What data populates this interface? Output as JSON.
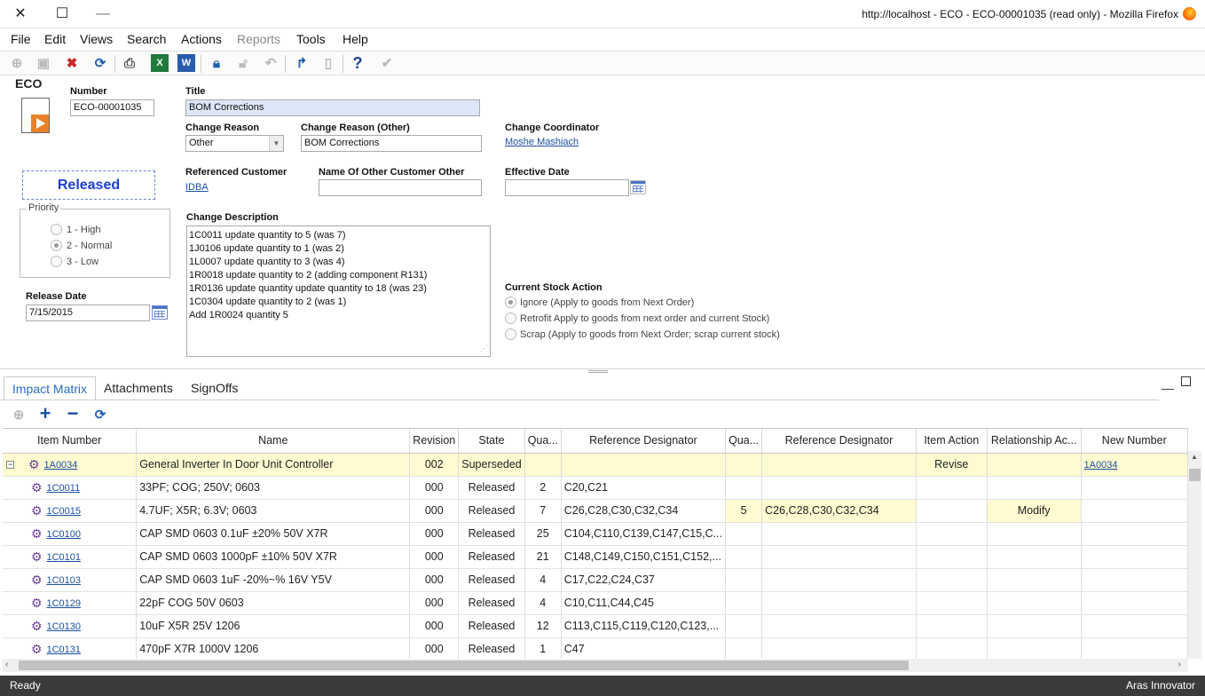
{
  "window": {
    "title": "http://localhost - ECO - ECO-00001035 (read only) - Mozilla Firefox",
    "close_glyph": "✕",
    "maximize_glyph": "☐",
    "minimize_glyph": "—"
  },
  "menu": [
    "File",
    "Edit",
    "Views",
    "Search",
    "Actions",
    "Reports",
    "Tools",
    "Help"
  ],
  "form": {
    "itemtype": "ECO",
    "number_label": "Number",
    "number": "ECO-00001035",
    "title_label": "Title",
    "title": "BOM Corrections",
    "change_reason_label": "Change Reason",
    "change_reason": "Other",
    "change_reason_other_label": "Change Reason (Other)",
    "change_reason_other": "BOM Corrections",
    "change_coordinator_label": "Change Coordinator",
    "change_coordinator": "Moshe Mashiach",
    "state": "Released",
    "referenced_customer_label": "Referenced Customer",
    "referenced_customer": "IDBA",
    "other_customer_label": "Name Of Other Customer Other",
    "other_customer": "",
    "effective_date_label": "Effective Date",
    "effective_date": "",
    "priority_label": "Priority",
    "priorities": [
      "1 - High",
      "2 - Normal",
      "3 - Low"
    ],
    "priority_selected": "2 - Normal",
    "release_date_label": "Release Date",
    "release_date": "7/15/2015",
    "change_description_label": "Change Description",
    "change_description": [
      "1C0011 update quantity to 5 (was 7)",
      "1J0106 update quantity  to 1 (was 2)",
      "1L0007 update quantity  to 3 (was 4)",
      "1R0018 update quantity to 2 (adding component R131)",
      "1R0136 update quantity update quantity  to 18 (was 23)",
      "1C0304 update quantity to 2 (was 1)",
      "Add 1R0024 quantity 5"
    ],
    "stock_action_label": "Current Stock Action",
    "stock_actions": [
      "Ignore (Apply to goods from Next Order)",
      "Retrofit Apply to goods from next order and current Stock)",
      "Scrap (Apply to goods from Next Order; scrap current stock)"
    ],
    "stock_action_selected": "Ignore (Apply to goods from Next Order)"
  },
  "tabs": [
    "Impact Matrix",
    "Attachments",
    "SignOffs"
  ],
  "grid": {
    "columns": [
      "Item Number",
      "Name",
      "Revision",
      "State",
      "Qua...",
      "Reference Designator",
      "Qua...",
      "Reference Designator",
      "Item Action",
      "Relationship Ac...",
      "New Number"
    ],
    "rows": [
      {
        "item": "1A0034",
        "name": "General Inverter In Door Unit Controller",
        "rev": "002",
        "state": "Superseded",
        "qty": "",
        "ref": "",
        "new_qty": "",
        "new_ref": "",
        "action": "Revise",
        "rel_action": "",
        "new_number": "1A0034",
        "parent": true
      },
      {
        "item": "1C0011",
        "name": "33PF; COG; 250V; 0603",
        "rev": "000",
        "state": "Released",
        "qty": "2",
        "ref": "C20,C21",
        "new_qty": "",
        "new_ref": "",
        "action": "",
        "rel_action": "",
        "new_number": ""
      },
      {
        "item": "1C0015",
        "name": "4.7UF; X5R; 6.3V; 0603",
        "rev": "000",
        "state": "Released",
        "qty": "7",
        "ref": "C26,C28,C30,C32,C34",
        "new_qty": "5",
        "new_ref": "C26,C28,C30,C32,C34",
        "action": "",
        "rel_action": "Modify",
        "new_number": ""
      },
      {
        "item": "1C0100",
        "name": "CAP SMD 0603 0.1uF ±20% 50V X7R",
        "rev": "000",
        "state": "Released",
        "qty": "25",
        "ref": "C104,C110,C139,C147,C15,C...",
        "new_qty": "",
        "new_ref": "",
        "action": "",
        "rel_action": "",
        "new_number": ""
      },
      {
        "item": "1C0101",
        "name": "CAP SMD 0603 1000pF ±10% 50V X7R",
        "rev": "000",
        "state": "Released",
        "qty": "21",
        "ref": "C148,C149,C150,C151,C152,...",
        "new_qty": "",
        "new_ref": "",
        "action": "",
        "rel_action": "",
        "new_number": ""
      },
      {
        "item": "1C0103",
        "name": "CAP SMD 0603 1uF -20%~% 16V Y5V",
        "rev": "000",
        "state": "Released",
        "qty": "4",
        "ref": "C17,C22,C24,C37",
        "new_qty": "",
        "new_ref": "",
        "action": "",
        "rel_action": "",
        "new_number": ""
      },
      {
        "item": "1C0129",
        "name": "22pF COG 50V 0603",
        "rev": "000",
        "state": "Released",
        "qty": "4",
        "ref": "C10,C11,C44,C45",
        "new_qty": "",
        "new_ref": "",
        "action": "",
        "rel_action": "",
        "new_number": ""
      },
      {
        "item": "1C0130",
        "name": "10uF X5R 25V 1206",
        "rev": "000",
        "state": "Released",
        "qty": "12",
        "ref": "C113,C115,C119,C120,C123,...",
        "new_qty": "",
        "new_ref": "",
        "action": "",
        "rel_action": "",
        "new_number": ""
      },
      {
        "item": "1C0131",
        "name": "470pF X7R 1000V 1206",
        "rev": "000",
        "state": "Released",
        "qty": "1",
        "ref": "C47",
        "new_qty": "",
        "new_ref": "",
        "action": "",
        "rel_action": "",
        "new_number": ""
      }
    ]
  },
  "status": {
    "left": "Ready",
    "right": "Aras Innovator"
  },
  "colors": {
    "accent": "#2a6ebd",
    "link": "#1a4fa3",
    "highlight_row": "#fffad0",
    "state_text": "#1d3fd1",
    "status_bar": "#3b3b3b"
  }
}
